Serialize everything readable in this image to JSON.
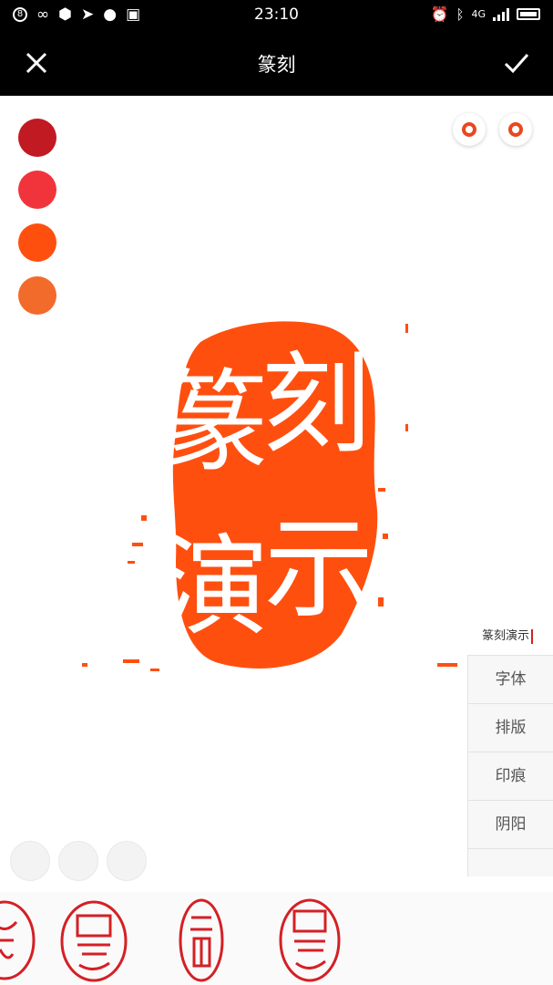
{
  "status_bar": {
    "time": "23:10",
    "notif_badge": "8",
    "network": "4G"
  },
  "toolbar": {
    "title": "篆刻",
    "close_icon": "close-icon",
    "confirm_icon": "check-icon"
  },
  "color_swatches": [
    "#c21a22",
    "#f1343b",
    "#ff4f0f",
    "#f26b2a"
  ],
  "seal": {
    "color": "#ff4f0f",
    "chars": [
      "篆",
      "刻",
      "演",
      "示"
    ]
  },
  "stamp_text": "篆刻演示",
  "side_menu": [
    "字体",
    "排版",
    "印痕",
    "阴阳"
  ],
  "bottom_templates": [
    "seal-template-1",
    "seal-template-2",
    "seal-template-3",
    "seal-template-4"
  ]
}
